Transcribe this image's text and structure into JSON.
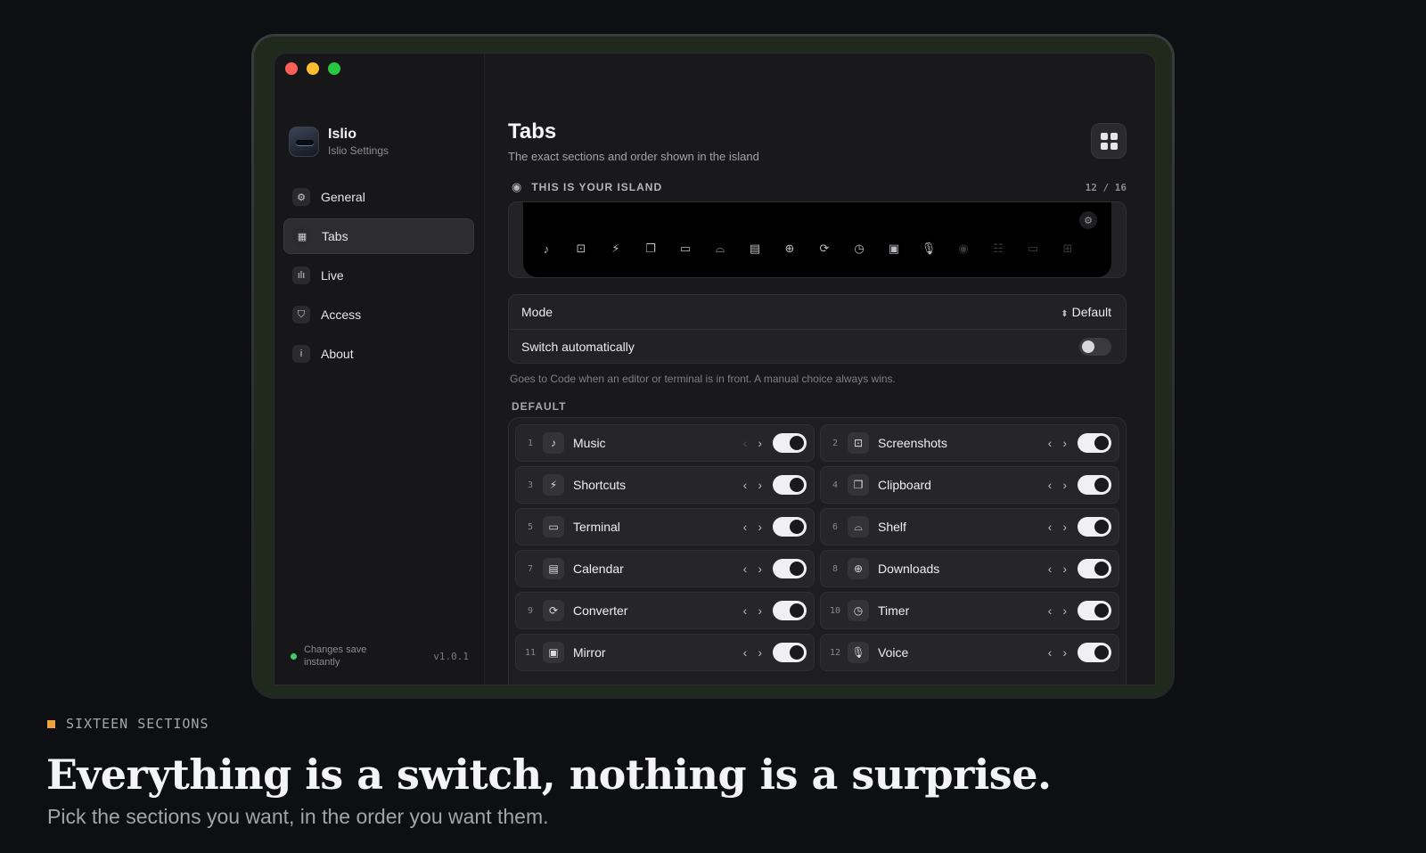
{
  "window": {
    "colors": {
      "close": "#ff5f57",
      "minimize": "#febc2e",
      "zoom": "#28c840"
    }
  },
  "sidebar": {
    "app_name": "Islio",
    "app_subtitle": "Islio Settings",
    "items": [
      {
        "label": "General",
        "icon": "gear-icon"
      },
      {
        "label": "Tabs",
        "icon": "grid-icon",
        "active": true
      },
      {
        "label": "Live",
        "icon": "waveform-icon"
      },
      {
        "label": "Access",
        "icon": "shield-icon"
      },
      {
        "label": "About",
        "icon": "info-icon"
      }
    ],
    "status": "Changes save instantly",
    "version": "v1.0.1"
  },
  "main": {
    "title": "Tabs",
    "subtitle": "The exact sections and order shown in the island",
    "island": {
      "heading": "THIS IS YOUR ISLAND",
      "count": "12 / 16",
      "icons": [
        "music-icon",
        "screenshot-icon",
        "shortcuts-icon",
        "clipboard-icon",
        "terminal-icon",
        "shelf-icon",
        "calendar-icon",
        "downloads-icon",
        "converter-icon",
        "timer-icon",
        "mirror-icon",
        "voice-icon",
        "disabled-icon-13",
        "disabled-icon-14",
        "disabled-icon-15",
        "disabled-icon-16"
      ]
    },
    "mode": {
      "label": "Mode",
      "value": "Default"
    },
    "switch": {
      "label": "Switch automatically",
      "enabled": false
    },
    "hint": "Goes to Code when an editor or terminal is in front. A manual choice always wins.",
    "section_label": "DEFAULT",
    "tabs": [
      {
        "num": "1",
        "label": "Music",
        "icon": "music-icon",
        "enabled": true
      },
      {
        "num": "2",
        "label": "Screenshots",
        "icon": "screenshot-icon",
        "enabled": true
      },
      {
        "num": "3",
        "label": "Shortcuts",
        "icon": "shortcuts-icon",
        "enabled": true
      },
      {
        "num": "4",
        "label": "Clipboard",
        "icon": "clipboard-icon",
        "enabled": true
      },
      {
        "num": "5",
        "label": "Terminal",
        "icon": "terminal-icon",
        "enabled": true
      },
      {
        "num": "6",
        "label": "Shelf",
        "icon": "shelf-icon",
        "enabled": true
      },
      {
        "num": "7",
        "label": "Calendar",
        "icon": "calendar-icon",
        "enabled": true
      },
      {
        "num": "8",
        "label": "Downloads",
        "icon": "downloads-icon",
        "enabled": true
      },
      {
        "num": "9",
        "label": "Converter",
        "icon": "converter-icon",
        "enabled": true
      },
      {
        "num": "10",
        "label": "Timer",
        "icon": "timer-icon",
        "enabled": true
      },
      {
        "num": "11",
        "label": "Mirror",
        "icon": "mirror-icon",
        "enabled": true
      },
      {
        "num": "12",
        "label": "Voice",
        "icon": "voice-icon",
        "enabled": true
      }
    ]
  },
  "caption": {
    "tag": "SIXTEEN SECTIONS",
    "headline": "Everything is a switch, nothing is a surprise.",
    "subline": "Pick the sections you want, in the order you want them.",
    "accent": "#f0a33a"
  }
}
